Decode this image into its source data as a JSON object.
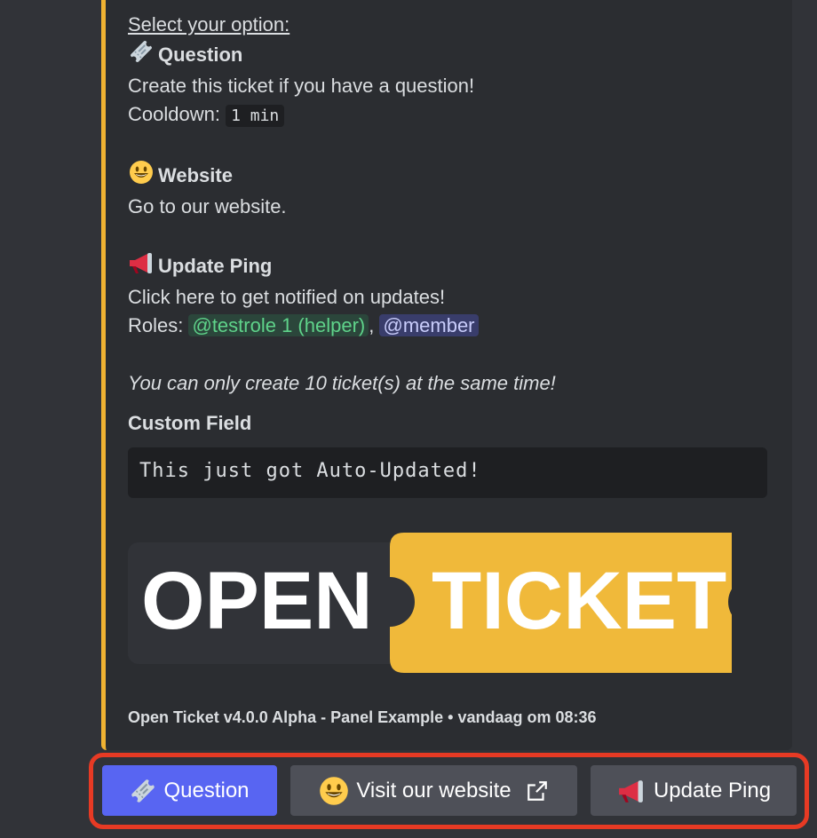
{
  "embed": {
    "accent_color": "#f0b232",
    "heading": "Select your option:",
    "options": [
      {
        "icon": "ticket-icon",
        "title": "Question",
        "description": "Create this ticket if you have a question!",
        "cooldown_label": "Cooldown:",
        "cooldown_value": "1 min"
      },
      {
        "icon": "smiley-icon",
        "title": "Website",
        "description": "Go to our website."
      },
      {
        "icon": "megaphone-icon",
        "title": "Update Ping",
        "description": "Click here to get notified on updates!",
        "roles_label": "Roles:",
        "roles": [
          "@testrole 1 (helper)",
          "@member"
        ],
        "separator": ","
      }
    ],
    "limit_note": "You can only create 10 ticket(s) at the same time!",
    "field": {
      "name": "Custom Field",
      "value": "This just got Auto-Updated!"
    },
    "banner": {
      "left_text": "OPEN",
      "right_text": "TICKET",
      "left_color": "#313338",
      "right_color": "#f0b93a"
    },
    "footer": "Open Ticket v4.0.0 Alpha - Panel Example • vandaag om 08:36"
  },
  "buttons": [
    {
      "label": "Question",
      "icon": "ticket-icon",
      "style": "primary",
      "color": "#5865f2"
    },
    {
      "label": "Visit our website",
      "icon": "smiley-icon",
      "style": "link",
      "trailing_icon": "external-link-icon",
      "color": "#4e5058"
    },
    {
      "label": "Update Ping",
      "icon": "megaphone-icon",
      "style": "secondary",
      "color": "#4e5058"
    }
  ],
  "highlight_color": "#e73a24"
}
